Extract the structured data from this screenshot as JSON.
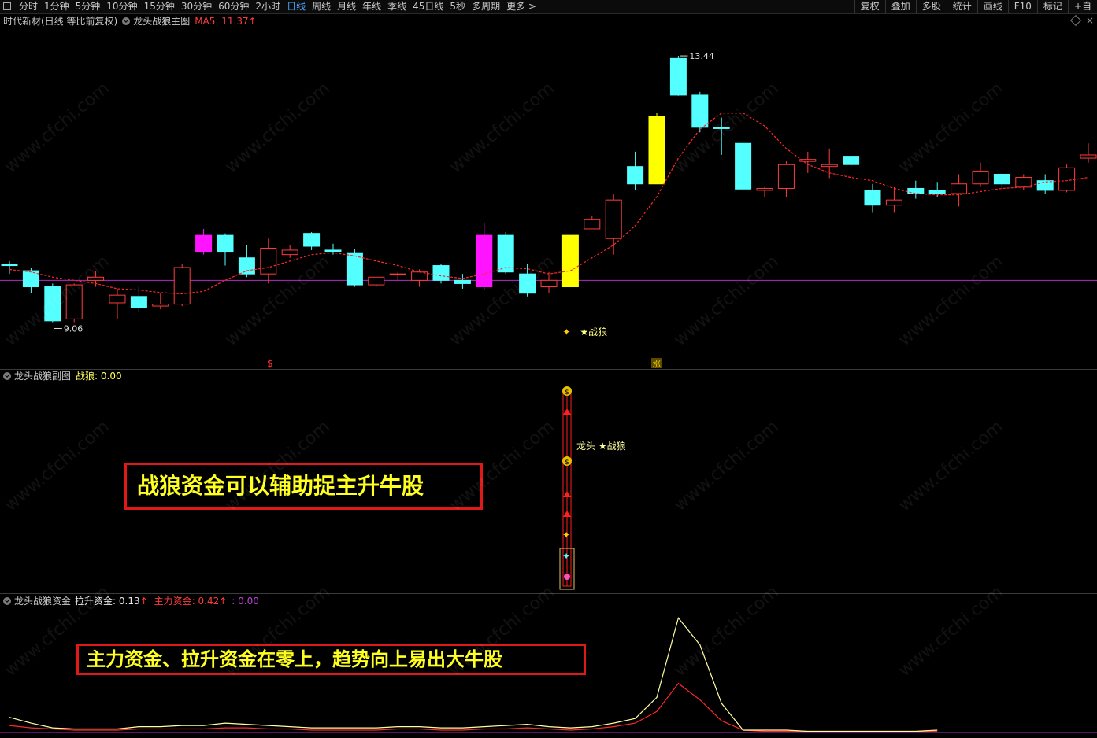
{
  "toolbar": {
    "left_items": [
      "分时",
      "1分钟",
      "5分钟",
      "10分钟",
      "15分钟",
      "30分钟",
      "60分钟",
      "2小时",
      "日线",
      "周线",
      "月线",
      "年线",
      "季线",
      "45日线",
      "5秒",
      "多周期",
      "更多 >"
    ],
    "active_item": "日线",
    "right_items": [
      "复权",
      "叠加",
      "多股",
      "统计",
      "画线",
      "F10",
      "标记",
      "+自"
    ]
  },
  "main_panel": {
    "stock_label": "时代新材(日线 等比前复权)",
    "indicator_name": "龙头战狼主图",
    "ma_label": "MA5: 11.37",
    "ma_arrow": "↑",
    "high_label": "13.44",
    "low_label": "9.06",
    "signal_label": "★战狼",
    "marker_dollar": "$",
    "marker_zhang": "涨"
  },
  "sub_panel": {
    "title": "龙头战狼副图",
    "value_label": "战狼: 0.00",
    "center_label": "龙头 ★战狼",
    "annotation": "战狼资金可以辅助捉主升牛股"
  },
  "fund_panel": {
    "title": "龙头战狼资金",
    "lashen_label": "拉升资金: 0.13",
    "lashen_arrow": "↑",
    "zhuli_label": "主力资金: 0.42",
    "zhuli_arrow": "↑",
    "third_label": ": 0.00",
    "annotation": "主力资金、拉升资金在零上，趋势向上易出大牛股"
  },
  "watermark": "www.cfchi.com",
  "colors": {
    "up": "#ff3c3c",
    "down": "#54ffff",
    "signal": "#ffff00",
    "magenta": "#ff14ff",
    "ma": "#ff2828",
    "purple": "#b428c8",
    "highlight_blue": "#4aa8ff"
  },
  "chart_data": {
    "type": "candlestick",
    "ohlc": [
      [
        10.2,
        10.25,
        10.05,
        10.18
      ],
      [
        10.1,
        10.15,
        9.75,
        9.85
      ],
      [
        9.85,
        9.9,
        9.3,
        9.32
      ],
      [
        9.35,
        9.9,
        9.3,
        9.88
      ],
      [
        9.95,
        10.1,
        9.85,
        10.0
      ],
      [
        9.6,
        9.82,
        9.35,
        9.72
      ],
      [
        9.7,
        9.85,
        9.45,
        9.53
      ],
      [
        9.55,
        9.75,
        9.5,
        9.58
      ],
      [
        9.58,
        10.2,
        9.55,
        10.15
      ],
      [
        10.65,
        10.75,
        10.35,
        10.4
      ],
      [
        10.65,
        10.68,
        10.18,
        10.4
      ],
      [
        10.3,
        10.5,
        10.0,
        10.05
      ],
      [
        10.05,
        10.6,
        9.9,
        10.45
      ],
      [
        10.35,
        10.5,
        10.3,
        10.42
      ],
      [
        10.68,
        10.7,
        10.42,
        10.48
      ],
      [
        10.42,
        10.52,
        10.35,
        10.4
      ],
      [
        10.38,
        10.44,
        9.85,
        9.88
      ],
      [
        9.88,
        10.0,
        9.85,
        10.0
      ],
      [
        10.05,
        10.08,
        9.95,
        10.05
      ],
      [
        9.95,
        10.12,
        9.85,
        10.08
      ],
      [
        10.18,
        10.2,
        9.9,
        9.95
      ],
      [
        9.95,
        10.05,
        9.82,
        9.9
      ],
      [
        9.85,
        10.85,
        9.8,
        10.65
      ],
      [
        10.65,
        10.7,
        10.05,
        10.08
      ],
      [
        10.05,
        10.2,
        9.7,
        9.75
      ],
      [
        9.85,
        10.08,
        9.75,
        9.95
      ],
      [
        9.85,
        10.65,
        9.85,
        10.65
      ],
      [
        10.75,
        10.95,
        10.75,
        10.9
      ],
      [
        10.6,
        11.3,
        10.35,
        11.2
      ],
      [
        11.72,
        11.95,
        11.35,
        11.45
      ],
      [
        11.45,
        12.55,
        11.45,
        12.5
      ],
      [
        13.4,
        13.44,
        12.82,
        12.83
      ],
      [
        12.83,
        12.88,
        12.25,
        12.33
      ],
      [
        12.33,
        12.48,
        11.9,
        12.31
      ],
      [
        12.08,
        12.08,
        11.35,
        11.37
      ],
      [
        11.35,
        11.4,
        11.25,
        11.38
      ],
      [
        11.38,
        11.8,
        11.25,
        11.75
      ],
      [
        11.8,
        11.95,
        11.62,
        11.83
      ],
      [
        11.72,
        12.0,
        11.54,
        11.75
      ],
      [
        11.88,
        11.88,
        11.72,
        11.75
      ],
      [
        11.35,
        11.45,
        11.0,
        11.12
      ],
      [
        11.12,
        11.4,
        11.0,
        11.2
      ],
      [
        11.38,
        11.5,
        11.22,
        11.3
      ],
      [
        11.35,
        11.48,
        11.25,
        11.3
      ],
      [
        11.3,
        11.6,
        11.1,
        11.45
      ],
      [
        11.45,
        11.78,
        11.4,
        11.65
      ],
      [
        11.6,
        11.62,
        11.38,
        11.45
      ],
      [
        11.4,
        11.6,
        11.35,
        11.55
      ],
      [
        11.5,
        11.6,
        11.3,
        11.35
      ],
      [
        11.35,
        11.75,
        11.32,
        11.7
      ],
      [
        11.85,
        12.08,
        11.78,
        11.9
      ]
    ],
    "special_bars": {
      "9": "magenta",
      "22": "magenta",
      "26": "signal",
      "30": "signal"
    },
    "ma5": [
      10.12,
      10.08,
      10.0,
      9.95,
      9.9,
      9.82,
      9.8,
      9.76,
      9.74,
      9.78,
      9.95,
      10.1,
      10.15,
      10.25,
      10.35,
      10.38,
      10.33,
      10.25,
      10.18,
      10.08,
      10.02,
      9.98,
      10.05,
      10.15,
      10.13,
      10.05,
      10.1,
      10.3,
      10.5,
      10.8,
      11.25,
      11.85,
      12.3,
      12.55,
      12.55,
      12.35,
      12.0,
      11.75,
      11.62,
      11.55,
      11.5,
      11.38,
      11.3,
      11.28,
      11.28,
      11.33,
      11.38,
      11.4,
      11.48,
      11.5,
      11.55
    ],
    "flat_line": 9.95,
    "ylim": [
      9.0,
      13.6
    ],
    "fund_lashen": [
      0.13,
      0.08,
      0.04,
      0.03,
      0.03,
      0.03,
      0.05,
      0.05,
      0.06,
      0.06,
      0.08,
      0.07,
      0.06,
      0.05,
      0.04,
      0.04,
      0.04,
      0.04,
      0.05,
      0.05,
      0.04,
      0.04,
      0.05,
      0.06,
      0.07,
      0.05,
      0.04,
      0.05,
      0.08,
      0.12,
      0.3,
      0.98,
      0.75,
      0.25,
      0.02,
      0.02,
      0.02,
      0.01,
      0.01,
      0.01,
      0.01,
      0.01,
      0.01,
      0.02
    ],
    "fund_zhuli": [
      0.06,
      0.04,
      0.03,
      0.02,
      0.02,
      0.02,
      0.03,
      0.03,
      0.03,
      0.03,
      0.04,
      0.04,
      0.03,
      0.03,
      0.02,
      0.02,
      0.02,
      0.02,
      0.03,
      0.03,
      0.02,
      0.02,
      0.03,
      0.03,
      0.04,
      0.03,
      0.02,
      0.03,
      0.05,
      0.08,
      0.18,
      0.42,
      0.28,
      0.1,
      0.02,
      0.01,
      0.01,
      0.01,
      0.01,
      0.01,
      0.01,
      0.01,
      0.01,
      0.01
    ],
    "fund_ylim": [
      0,
      1.05
    ]
  }
}
